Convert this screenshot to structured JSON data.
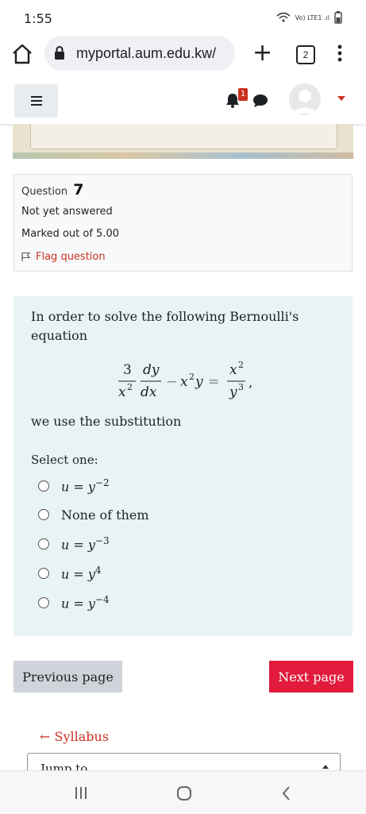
{
  "status": {
    "time": "1:55",
    "icons": "Vo) LTE1 .ıl"
  },
  "browser": {
    "url": "myportal.aum.edu.kw/",
    "tab_count": "2"
  },
  "navbar": {
    "notification_count": "1"
  },
  "question_info": {
    "label": "Question",
    "number": "7",
    "state": "Not yet answered",
    "grade": "Marked out of 5.00",
    "flag": "Flag question"
  },
  "question": {
    "text": "In order to solve the following Bernoulli's equation",
    "substitution": "we use the substitution",
    "prompt": "Select one:",
    "options": [
      {
        "base": "u = y",
        "exp": "−2"
      },
      {
        "base": "None of them",
        "exp": ""
      },
      {
        "base": "u = y",
        "exp": "−3"
      },
      {
        "base": "u = y",
        "exp": "4"
      },
      {
        "base": "u = y",
        "exp": "−4"
      }
    ]
  },
  "buttons": {
    "previous": "Previous page",
    "next": "Next page"
  },
  "footer": {
    "syllabus": "← Syllabus",
    "jump": "Jump to..."
  }
}
